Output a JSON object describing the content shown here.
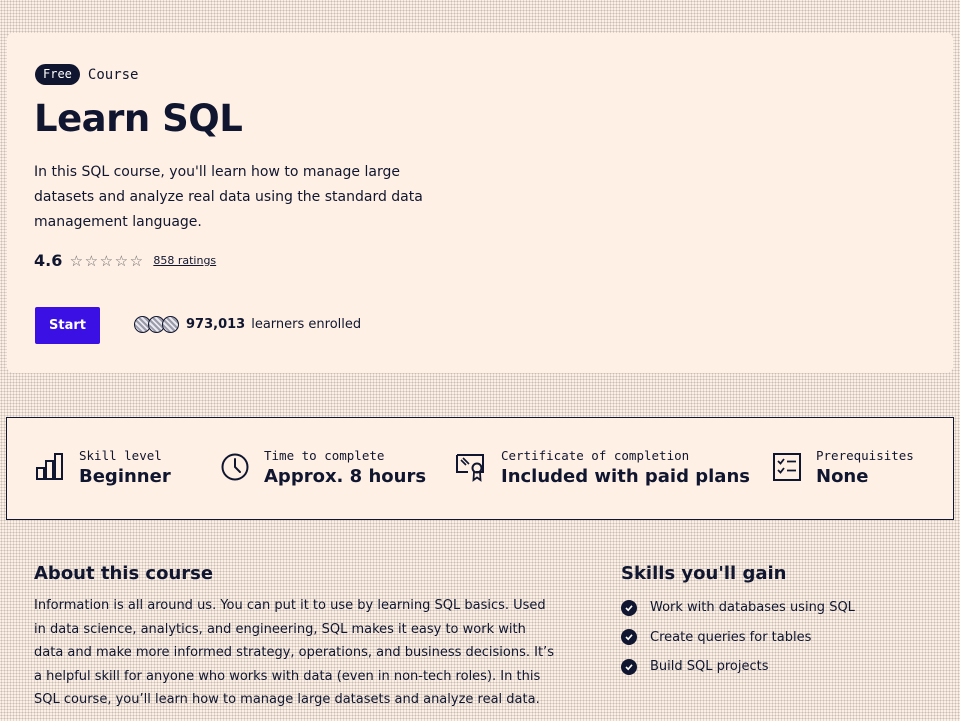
{
  "hero": {
    "badge": "Free",
    "course_type": "Course",
    "title": "Learn SQL",
    "description": "In this SQL course, you'll learn how to manage large datasets and analyze real data using the standard data management language.",
    "rating": "4.6",
    "stars": 4.6,
    "ratings_link": "858 ratings",
    "start_label": "Start",
    "enrolled_count": "973,013",
    "enrolled_text": "learners enrolled"
  },
  "stats": [
    {
      "label": "Skill level",
      "value": "Beginner",
      "icon": "bar-chart-icon"
    },
    {
      "label": "Time to complete",
      "value": "Approx. 8 hours",
      "icon": "clock-icon"
    },
    {
      "label": "Certificate of completion",
      "value": "Included with paid plans",
      "icon": "certificate-icon"
    },
    {
      "label": "Prerequisites",
      "value": "None",
      "icon": "checklist-icon"
    }
  ],
  "about": {
    "title": "About this course",
    "body": "Information is all around us. You can put it to use by learning SQL basics. Used in data science, analytics, and engineering, SQL makes it easy to work with data and make more informed strategy, operations, and business decisions. It’s a helpful skill for anyone who works with data (even in non-tech roles). In this SQL course, you’ll learn how to manage large datasets and analyze real data."
  },
  "skills": {
    "title": "Skills you'll gain",
    "items": [
      "Work with databases using SQL",
      "Create queries for tables",
      "Build SQL projects"
    ]
  },
  "colors": {
    "primary": "#3a10e5",
    "ink": "#10162f",
    "background": "#fff0e5"
  }
}
